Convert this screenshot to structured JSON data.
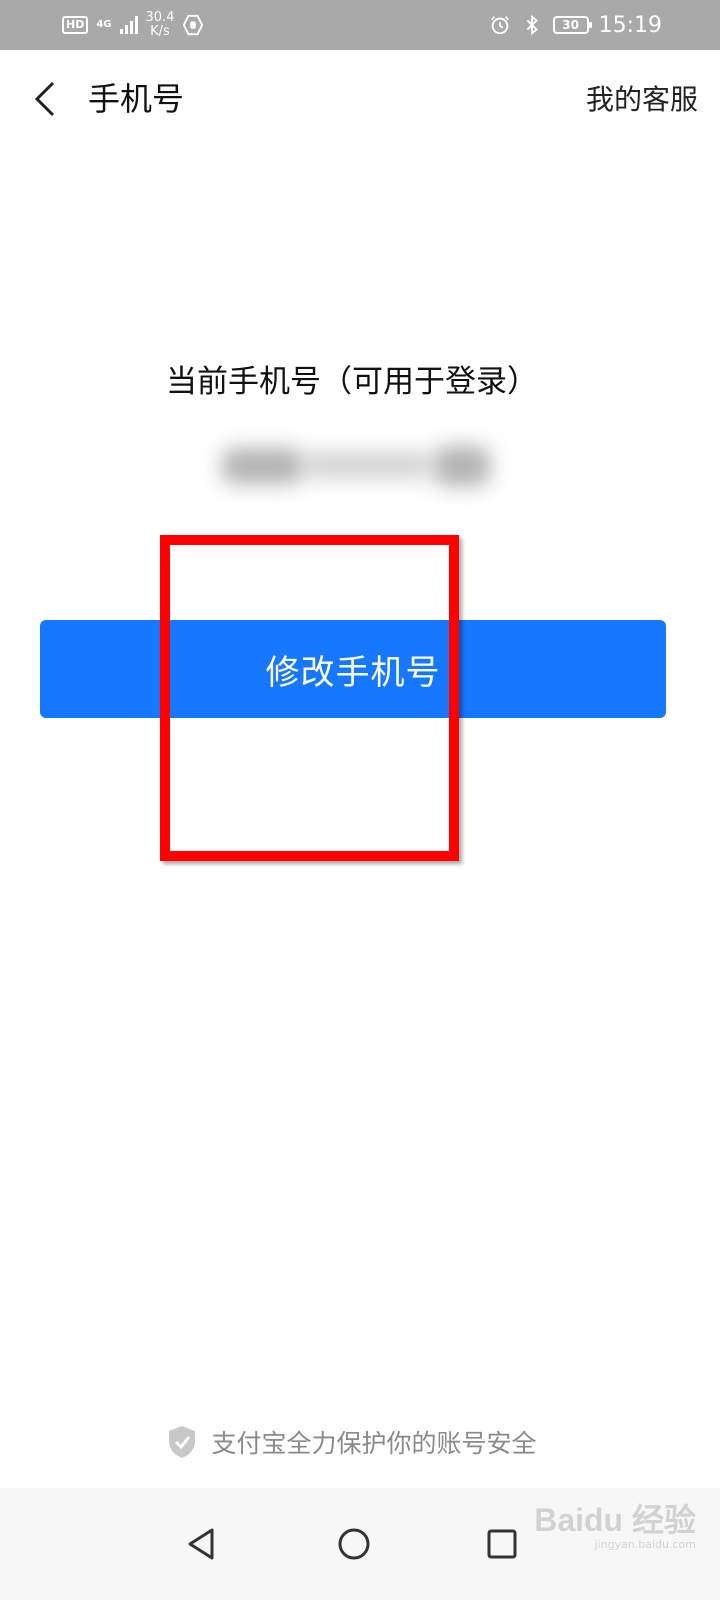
{
  "status_bar": {
    "hd": "HD",
    "network_type": "4G",
    "net_speed_value": "30.4",
    "net_speed_unit": "K/s",
    "battery": "30",
    "time": "15:19"
  },
  "header": {
    "title": "手机号",
    "service_link": "我的客服"
  },
  "main": {
    "current_label": "当前手机号（可用于登录）",
    "change_button_label": "修改手机号"
  },
  "footer": {
    "security_text": "支付宝全力保护你的账号安全"
  },
  "watermark": {
    "brand": "Baidu 经验",
    "url": "jingyan.baidu.com"
  },
  "colors": {
    "accent": "#1677ff",
    "highlight": "#ff0000",
    "status_bar": "#a9a9a9"
  },
  "icons": [
    "back-icon",
    "shield-icon",
    "nav-back-icon",
    "nav-home-icon",
    "nav-recent-icon",
    "alarm-icon",
    "bluetooth-icon"
  ]
}
